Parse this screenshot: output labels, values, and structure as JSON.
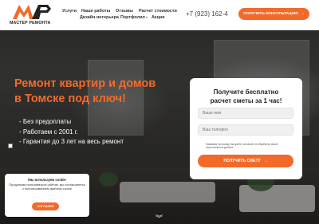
{
  "colors": {
    "accent": "#f26a2a",
    "header_bg": "#ffffff"
  },
  "logo": {
    "mark": "MP",
    "text": "МАСТЕР РЕМОНТА"
  },
  "nav": {
    "items": [
      {
        "label": "Услуги"
      },
      {
        "label": "Наши работы"
      },
      {
        "label": "Отзывы"
      },
      {
        "label": "Расчет стоимости"
      },
      {
        "label": "Дизайн интерьера"
      },
      {
        "label": "Портфолио",
        "caret": "▾"
      },
      {
        "label": "Акции"
      }
    ]
  },
  "header": {
    "phone": "+7 (923) 162-4",
    "consult_button": "ПОЛУЧИТЬ КОНСУЛЬТАЦИЮ",
    "consult_icon": "arrow-right-icon"
  },
  "hero": {
    "title_line1": "Ремонт квартир и домов",
    "title_line2": "в Томске под ключ!",
    "bullets": [
      "- Без предоплаты",
      "- Работаем с 2001 г.",
      "- Гарантия до 3 лет на весь ремонт"
    ]
  },
  "form": {
    "title_line1": "Получите бесплатно",
    "title_line2": "расчет сметы за 1 час!",
    "name_placeholder": "Ваше имя",
    "phone_placeholder": "Ваш телефон",
    "consent": "Нажимая на кнопку, вы даете согласие на обработку своих персональных данных",
    "submit": "ПОЛУЧИТЬ СМЕТУ",
    "submit_icon": "arrow-right-icon"
  },
  "cookie": {
    "title": "Мы используем cookie",
    "body": "Продолжая пользоваться сайтом, вы соглашаетесь с использованием файлов cookie",
    "button": "СОГЛАСЕН"
  },
  "scroll_hint_icon": "chevron-down-icon"
}
